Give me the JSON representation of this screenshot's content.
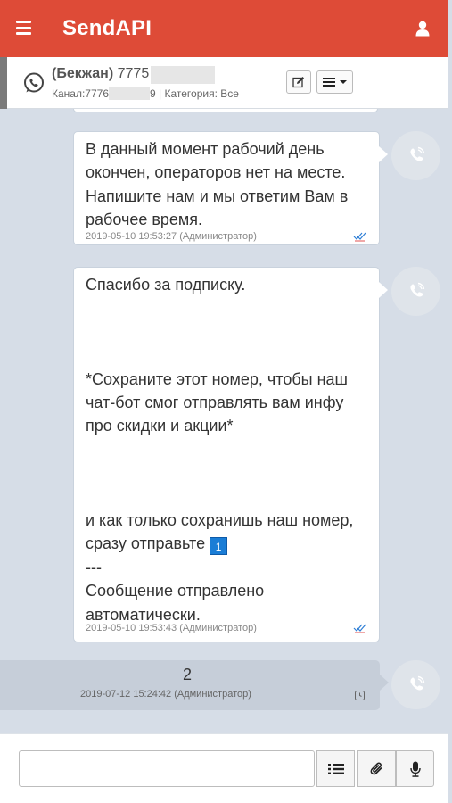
{
  "app": {
    "brand": "SendAPI"
  },
  "chat": {
    "contact_prefix": "(Бекжан)",
    "contact_number_visible": "7775",
    "channel_label": "Канал:7776",
    "channel_tail": "9",
    "category_label": "| Категория: Все"
  },
  "messages": [
    {
      "text": "В данный момент рабочий день окончен, операторов нет на месте. Напишите нам и мы ответим Вам в рабочее время.",
      "timestamp": "2019-05-10 19:53:27 (Администратор)",
      "status": "double-check-icon"
    },
    {
      "text_part1": "Спасибо за подписку.\n\n\n\n*Сохраните этот номер, чтобы наш чат-бот смог отправлять вам инфу про скидки и акции*\n\n\n\nи как только сохранишь наш номер, сразу отправьте ",
      "keycap": "1",
      "text_part2": "\n---\nСообщение отправлено автоматически.",
      "timestamp": "2019-05-10 19:53:43 (Администратор)",
      "status": "double-check-icon"
    },
    {
      "text": "2",
      "timestamp": "2019-07-12 15:24:42 (Администратор)",
      "status": "clock-icon"
    }
  ],
  "composer": {
    "input_value": "",
    "input_placeholder": ""
  },
  "colors": {
    "navbar": "#de4b37",
    "background": "#d6dde7",
    "outgoing_bubble": "#c6ced9",
    "read_ticks": "#2f7fd6"
  }
}
